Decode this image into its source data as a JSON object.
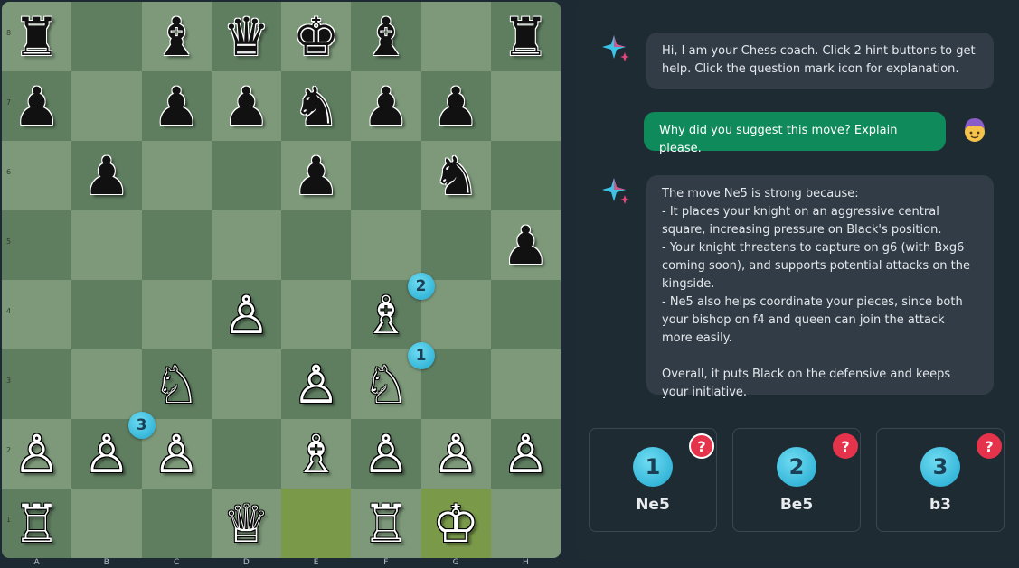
{
  "board": {
    "files": [
      "A",
      "B",
      "C",
      "D",
      "E",
      "F",
      "G",
      "H"
    ],
    "ranks": [
      "8",
      "7",
      "6",
      "5",
      "4",
      "3",
      "2",
      "1"
    ],
    "highlighted_squares": [
      "e1",
      "g1"
    ],
    "pieces": [
      {
        "sq": "a8",
        "glyph": "♜",
        "color": "b",
        "name": "black-rook-a8"
      },
      {
        "sq": "c8",
        "glyph": "♝",
        "color": "b",
        "name": "black-bishop-c8"
      },
      {
        "sq": "d8",
        "glyph": "♛",
        "color": "b",
        "name": "black-queen-d8"
      },
      {
        "sq": "e8",
        "glyph": "♚",
        "color": "b",
        "name": "black-king-e8"
      },
      {
        "sq": "f8",
        "glyph": "♝",
        "color": "b",
        "name": "black-bishop-f8"
      },
      {
        "sq": "h8",
        "glyph": "♜",
        "color": "b",
        "name": "black-rook-h8"
      },
      {
        "sq": "a7",
        "glyph": "♟",
        "color": "b",
        "name": "black-pawn-a7"
      },
      {
        "sq": "c7",
        "glyph": "♟",
        "color": "b",
        "name": "black-pawn-c7"
      },
      {
        "sq": "d7",
        "glyph": "♟",
        "color": "b",
        "name": "black-pawn-d7"
      },
      {
        "sq": "e7",
        "glyph": "♞",
        "color": "b",
        "name": "black-knight-e7"
      },
      {
        "sq": "f7",
        "glyph": "♟",
        "color": "b",
        "name": "black-pawn-f7"
      },
      {
        "sq": "g7",
        "glyph": "♟",
        "color": "b",
        "name": "black-pawn-g7"
      },
      {
        "sq": "b6",
        "glyph": "♟",
        "color": "b",
        "name": "black-pawn-b6"
      },
      {
        "sq": "e6",
        "glyph": "♟",
        "color": "b",
        "name": "black-pawn-e6"
      },
      {
        "sq": "g6",
        "glyph": "♞",
        "color": "b",
        "name": "black-knight-g6"
      },
      {
        "sq": "h5",
        "glyph": "♟",
        "color": "b",
        "name": "black-pawn-h5"
      },
      {
        "sq": "d4",
        "glyph": "♙",
        "color": "w",
        "name": "white-pawn-d4"
      },
      {
        "sq": "f4",
        "glyph": "♗",
        "color": "w",
        "name": "white-bishop-f4"
      },
      {
        "sq": "c3",
        "glyph": "♘",
        "color": "w",
        "name": "white-knight-c3"
      },
      {
        "sq": "e3",
        "glyph": "♙",
        "color": "w",
        "name": "white-pawn-e3"
      },
      {
        "sq": "f3",
        "glyph": "♘",
        "color": "w",
        "name": "white-knight-f3"
      },
      {
        "sq": "a2",
        "glyph": "♙",
        "color": "w",
        "name": "white-pawn-a2"
      },
      {
        "sq": "b2",
        "glyph": "♙",
        "color": "w",
        "name": "white-pawn-b2"
      },
      {
        "sq": "c2",
        "glyph": "♙",
        "color": "w",
        "name": "white-pawn-c2"
      },
      {
        "sq": "e2",
        "glyph": "♗",
        "color": "w",
        "name": "white-bishop-e2"
      },
      {
        "sq": "f2",
        "glyph": "♙",
        "color": "w",
        "name": "white-pawn-f2"
      },
      {
        "sq": "g2",
        "glyph": "♙",
        "color": "w",
        "name": "white-pawn-g2"
      },
      {
        "sq": "h2",
        "glyph": "♙",
        "color": "w",
        "name": "white-pawn-h2"
      },
      {
        "sq": "a1",
        "glyph": "♖",
        "color": "w",
        "name": "white-rook-a1"
      },
      {
        "sq": "d1",
        "glyph": "♕",
        "color": "w",
        "name": "white-queen-d1"
      },
      {
        "sq": "f1",
        "glyph": "♖",
        "color": "w",
        "name": "white-rook-f1"
      },
      {
        "sq": "g1",
        "glyph": "♔",
        "color": "w",
        "name": "white-king-g1"
      }
    ],
    "hint_markers": [
      {
        "label": "1",
        "near": "f3"
      },
      {
        "label": "2",
        "near": "f4"
      },
      {
        "label": "3",
        "near": "b2"
      }
    ]
  },
  "chat": {
    "bot_avatar_icon": "sparkle-icon",
    "user_avatar_icon": "user-avatar-icon",
    "messages": [
      {
        "from": "bot",
        "text": "Hi, I am your Chess coach. Click 2 hint buttons to get help. Click the question mark icon for explanation."
      },
      {
        "from": "user",
        "text": "Why did you suggest this move? Explain please."
      },
      {
        "from": "bot",
        "text": "The move Ne5 is strong because:\n- It places your knight on an aggressive central square, increasing pressure on Black's position.\n- Your knight threatens to capture on g6 (with Bxg6 coming soon), and supports potential attacks on the kingside.\n- Ne5 also helps coordinate your pieces, since both your bishop on f4 and queen can join the attack more easily.\n\nOverall, it puts Black on the defensive and keeps your initiative."
      }
    ]
  },
  "hints": [
    {
      "number": "1",
      "move": "Ne5",
      "help": "?",
      "help_active": true
    },
    {
      "number": "2",
      "move": "Be5",
      "help": "?",
      "help_active": false
    },
    {
      "number": "3",
      "move": "b3",
      "help": "?",
      "help_active": false
    }
  ],
  "colors": {
    "light_square": "#7d997a",
    "dark_square": "#5f7e60",
    "highlight_square": "#7a9a4a",
    "marker": "#3cc3e6",
    "help_button": "#e4334a",
    "user_bubble": "#0f8a5a",
    "bot_bubble": "#323c46"
  }
}
